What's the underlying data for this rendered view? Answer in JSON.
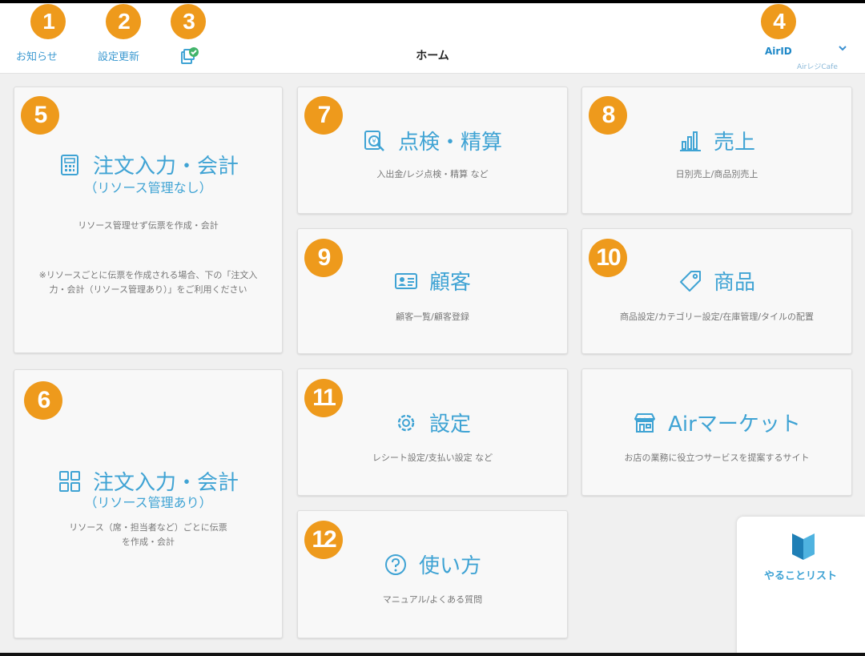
{
  "header": {
    "notice_label": "お知らせ",
    "settings_update_label": "設定更新",
    "title": "ホーム",
    "account_label": "AirID",
    "store_label": "AirレジCafe"
  },
  "badges": [
    "1",
    "2",
    "3",
    "4",
    "5",
    "6",
    "7",
    "8",
    "9",
    "10",
    "11",
    "12"
  ],
  "cards": {
    "order_no_resource": {
      "title": "注文入力・会計",
      "subtitle": "（リソース管理なし）",
      "desc1": "リソース管理せず伝票を作成・会計",
      "desc2": "※リソースごとに伝票を作成される場合、下の「注文入力・会計（リソース管理あり）」をご利用ください",
      "icon": "calculator-icon"
    },
    "order_with_resource": {
      "title": "注文入力・会計",
      "subtitle": "（リソース管理あり）",
      "desc": "リソース（席・担当者など）ごとに伝票を作成・会計",
      "icon": "grid-icon"
    },
    "inspection": {
      "title": "点検・精算",
      "desc": "入出金/レジ点検・精算 など",
      "icon": "inspection-icon"
    },
    "sales": {
      "title": "売上",
      "desc": "日別売上/商品別売上",
      "icon": "bar-chart-icon"
    },
    "customers": {
      "title": "顧客",
      "desc": "顧客一覧/顧客登録",
      "icon": "customer-card-icon"
    },
    "products": {
      "title": "商品",
      "desc": "商品設定/カテゴリー設定/在庫管理/タイルの配置",
      "icon": "tag-icon"
    },
    "settings": {
      "title": "設定",
      "desc": "レシート設定/支払い設定 など",
      "icon": "gear-icon"
    },
    "air_market": {
      "title": "Airマーケット",
      "desc": "お店の業務に役立つサービスを提案するサイト",
      "icon": "store-icon"
    },
    "help": {
      "title": "使い方",
      "desc": "マニュアル/よくある質問",
      "icon": "question-icon"
    }
  },
  "todo": {
    "label": "やることリスト",
    "icon": "beginner-mark-icon"
  },
  "colors": {
    "accent": "#3fa3d4",
    "badge": "#ee9a1c",
    "background": "#f0f0f0"
  }
}
